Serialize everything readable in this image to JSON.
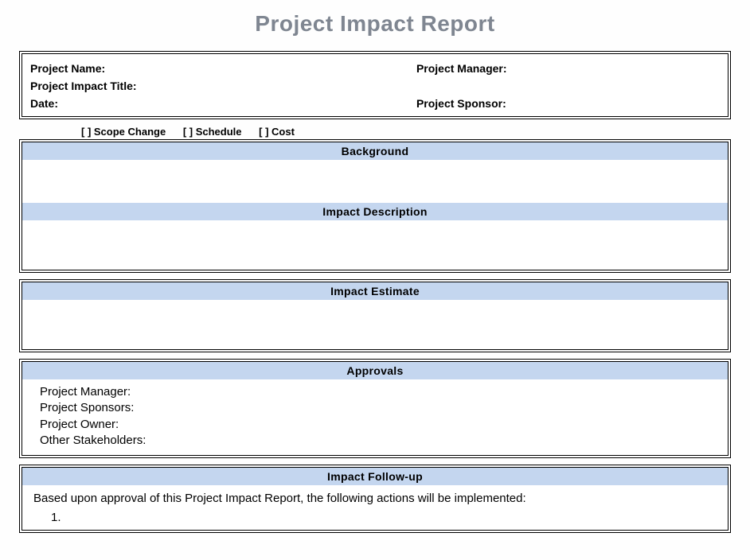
{
  "title": "Project Impact Report",
  "header": {
    "project_name_label": "Project Name:",
    "project_manager_label": "Project Manager:",
    "impact_title_label": "Project Impact Title:",
    "date_label": "Date:",
    "project_sponsor_label": "Project Sponsor:"
  },
  "checkboxes": {
    "scope_change": "[  ] Scope Change",
    "schedule": "[  ] Schedule",
    "cost": "[  ] Cost"
  },
  "sections": {
    "background": "Background",
    "impact_description": "Impact  Description",
    "impact_estimate": "Impact  Estimate",
    "approvals": "Approvals",
    "impact_followup": "Impact  Follow-up"
  },
  "approvals": {
    "project_manager": "Project Manager:",
    "project_sponsors": "Project Sponsors:",
    "project_owner": "Project Owner:",
    "other_stakeholders": "Other Stakeholders:"
  },
  "followup": {
    "intro": "Based upon approval of this Project Impact Report, the following actions will be implemented:",
    "item1": "1."
  }
}
